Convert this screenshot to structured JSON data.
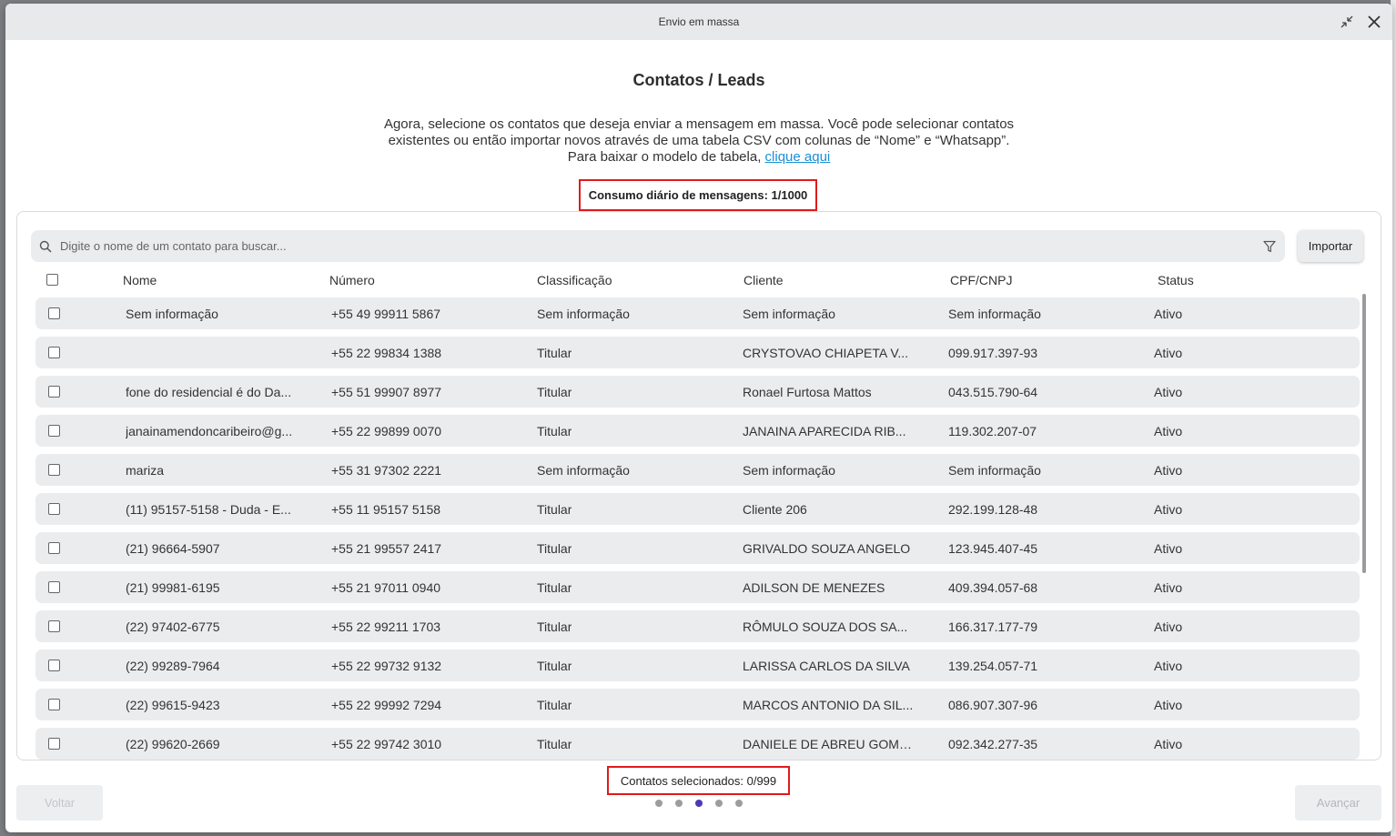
{
  "window": {
    "title": "Envio em massa"
  },
  "heading": "Contatos / Leads",
  "description": {
    "text_before_link": "Agora, selecione os contatos que deseja enviar a mensagem em massa. Você pode selecionar contatos existentes ou então importar novos através de uma tabela CSV com colunas de “Nome” e “Whatsapp”. Para baixar o modelo de tabela,",
    "link_text": "clique aqui"
  },
  "consumo": "Consumo diário de mensagens: 1/1000",
  "search": {
    "placeholder": "Digite o nome de um contato para buscar..."
  },
  "import_label": "Importar",
  "table": {
    "columns": [
      "Nome",
      "Número",
      "Classificação",
      "Cliente",
      "CPF/CNPJ",
      "Status"
    ],
    "rows": [
      [
        "Sem informação",
        "+55 49 99911 5867",
        "Sem informação",
        "Sem informação",
        "Sem informação",
        "Ativo"
      ],
      [
        "",
        "+55 22 99834 1388",
        "Titular",
        "CRYSTOVAO CHIAPETA V...",
        "099.917.397-93",
        "Ativo"
      ],
      [
        "fone do residencial é do Da...",
        "+55 51 99907 8977",
        "Titular",
        "Ronael Furtosa Mattos",
        "043.515.790-64",
        "Ativo"
      ],
      [
        "janainamendoncaribeiro@g...",
        "+55 22 99899 0070",
        "Titular",
        "JANAINA APARECIDA RIB...",
        "119.302.207-07",
        "Ativo"
      ],
      [
        "mariza",
        "+55 31 97302 2221",
        "Sem informação",
        "Sem informação",
        "Sem informação",
        "Ativo"
      ],
      [
        "(11) 95157-5158 - Duda - E...",
        "+55 11 95157 5158",
        "Titular",
        "Cliente 206",
        "292.199.128-48",
        "Ativo"
      ],
      [
        "(21) 96664-5907",
        "+55 21 99557 2417",
        "Titular",
        "GRIVALDO SOUZA ANGELO",
        "123.945.407-45",
        "Ativo"
      ],
      [
        "(21) 99981-6195",
        "+55 21 97011 0940",
        "Titular",
        "ADILSON DE MENEZES",
        "409.394.057-68",
        "Ativo"
      ],
      [
        "(22) 97402-6775",
        "+55 22 99211 1703",
        "Titular",
        "RÔMULO SOUZA DOS SA...",
        "166.317.177-79",
        "Ativo"
      ],
      [
        "(22) 99289-7964",
        "+55 22 99732 9132",
        "Titular",
        "LARISSA CARLOS DA SILVA",
        "139.254.057-71",
        "Ativo"
      ],
      [
        "(22) 99615-9423",
        "+55 22 99992 7294",
        "Titular",
        "MARCOS ANTONIO DA SIL...",
        "086.907.307-96",
        "Ativo"
      ],
      [
        "(22) 99620-2669",
        "+55 22 99742 3010",
        "Titular",
        "DANIELE DE ABREU GOMES",
        "092.342.277-35",
        "Ativo"
      ]
    ]
  },
  "selecionados": "Contatos selecionados: 0/999",
  "stepper": {
    "total_steps": 5,
    "current_step": 3
  },
  "footer": {
    "back_label": "Voltar",
    "next_label": "Avançar"
  },
  "colors": {
    "highlight_border": "#e11a1a",
    "link": "#1a8fd6",
    "active_step": "#4b3ab5"
  },
  "icons": [
    "minimize-icon",
    "close-icon",
    "search-icon",
    "filter-icon"
  ]
}
